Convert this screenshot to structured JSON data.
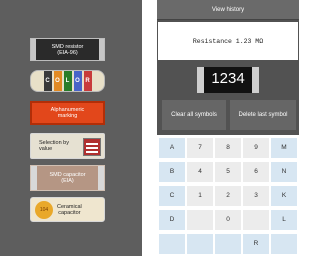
{
  "left": {
    "smd_resistor": {
      "line1": "SMD resistor",
      "line2": "(EIA-96)"
    },
    "color_code": {
      "letters": [
        "C",
        "O",
        "L",
        "O",
        "R"
      ],
      "band_colors": [
        "#3a3a3a",
        "#e28a23",
        "#2a7d2a",
        "#4864c8",
        "#c83b3b"
      ]
    },
    "alphanumeric": {
      "line1": "Alphanumeric",
      "line2": "marking"
    },
    "selection": {
      "line1": "Selection by",
      "line2": "value"
    },
    "smd_capacitor": {
      "line1": "SMD capacitor",
      "line2": "(EIA)"
    },
    "ceramic": {
      "icon_text": "104",
      "line1": "Ceramical",
      "line2": "capacitor"
    }
  },
  "right": {
    "view_history": "View history",
    "result": "Resistance 1.23 MΩ",
    "code": "1234",
    "clear_all": "Clear all symbols",
    "delete_last": "Delete last symbol",
    "keys": [
      {
        "label": "A",
        "color": "blue"
      },
      {
        "label": "7",
        "color": "gray"
      },
      {
        "label": "8",
        "color": "gray"
      },
      {
        "label": "9",
        "color": "gray"
      },
      {
        "label": "M",
        "color": "blue"
      },
      {
        "label": "B",
        "color": "blue"
      },
      {
        "label": "4",
        "color": "gray"
      },
      {
        "label": "5",
        "color": "gray"
      },
      {
        "label": "6",
        "color": "gray"
      },
      {
        "label": "N",
        "color": "blue"
      },
      {
        "label": "C",
        "color": "blue"
      },
      {
        "label": "1",
        "color": "gray"
      },
      {
        "label": "2",
        "color": "gray"
      },
      {
        "label": "3",
        "color": "gray"
      },
      {
        "label": "K",
        "color": "blue"
      },
      {
        "label": "D",
        "color": "blue"
      },
      {
        "label": "",
        "color": "gray"
      },
      {
        "label": "0",
        "color": "gray"
      },
      {
        "label": "",
        "color": "gray"
      },
      {
        "label": "L",
        "color": "blue"
      },
      {
        "label": "",
        "color": "blue"
      },
      {
        "label": "",
        "color": "blue"
      },
      {
        "label": "",
        "color": "blue"
      },
      {
        "label": "R",
        "color": "blue"
      },
      {
        "label": "",
        "color": "blue"
      }
    ]
  }
}
